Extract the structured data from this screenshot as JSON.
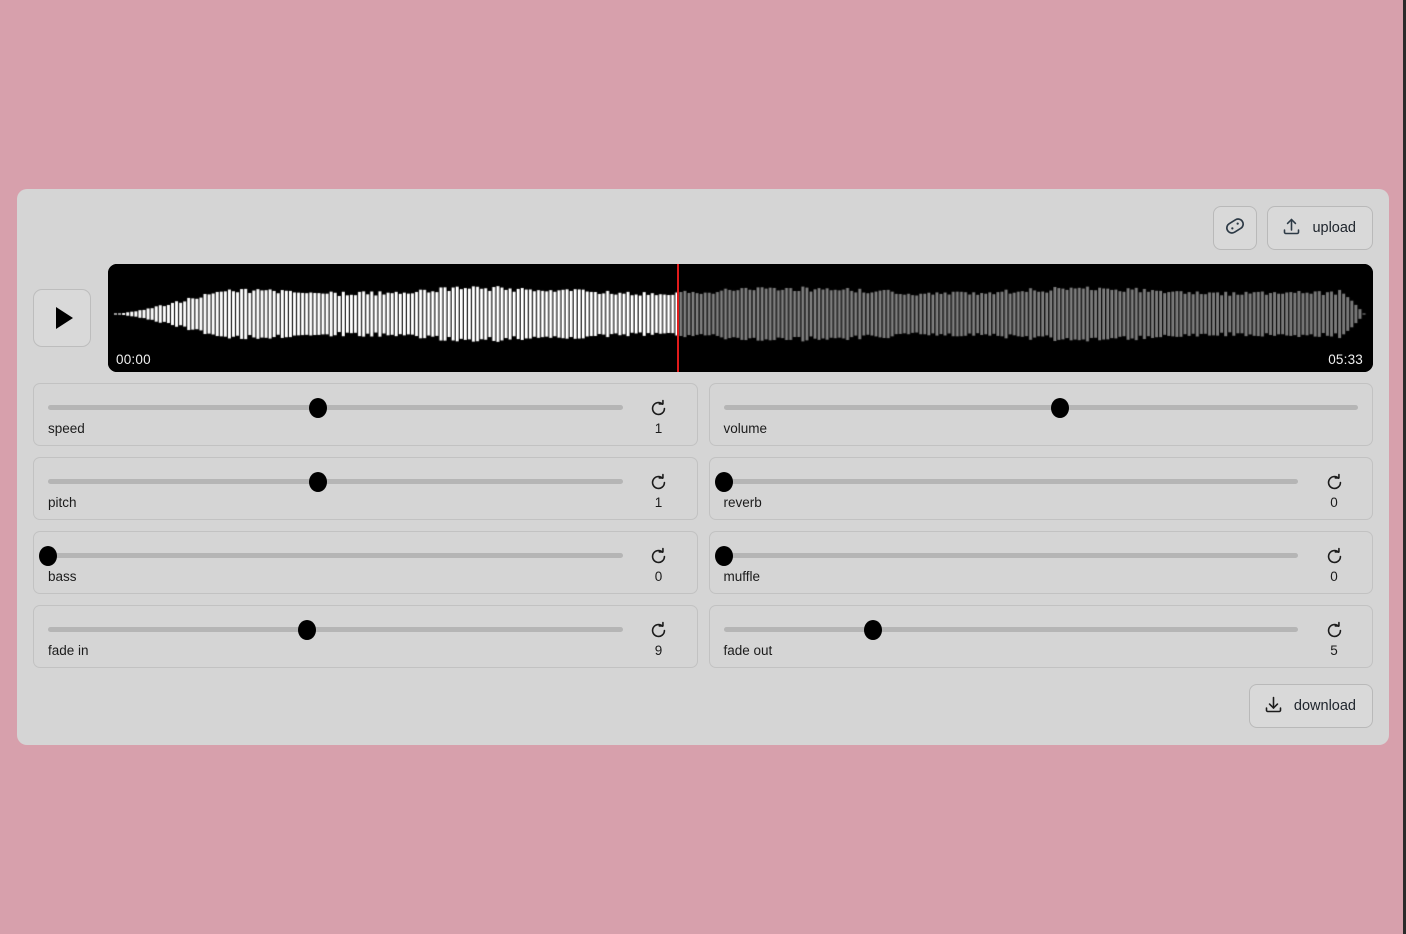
{
  "theme": {
    "page_background": "#d7a0ac",
    "panel_background": "#d5d5d5",
    "control_background": "#d5d5d5",
    "track_color": "#b5b5b5",
    "thumb_color": "#000000",
    "waveform_played_color": "#ffffff",
    "waveform_unplayed_color": "#7a7a7a",
    "waveform_background": "#000000",
    "playhead_color": "#e01b1b",
    "text_color": "#1b1b1b"
  },
  "toolbar": {
    "tag_button": {
      "icon": "tag-icon",
      "label": ""
    },
    "upload_button": {
      "icon": "upload-icon",
      "label": "upload"
    }
  },
  "player": {
    "play_button": {
      "icon": "play-icon",
      "label": ""
    },
    "current_time": "00:00",
    "total_time": "05:33",
    "playhead_percent": 45
  },
  "controls": [
    {
      "name": "speed",
      "label": "speed",
      "value": "1",
      "percent": 47,
      "reset_icon": "rotate-cw-icon",
      "has_reset": true,
      "column": "left"
    },
    {
      "name": "volume",
      "label": "volume",
      "value": "",
      "percent": 53,
      "reset_icon": "",
      "has_reset": false,
      "column": "right"
    },
    {
      "name": "pitch",
      "label": "pitch",
      "value": "1",
      "percent": 47,
      "reset_icon": "rotate-cw-icon",
      "has_reset": true,
      "column": "left"
    },
    {
      "name": "reverb",
      "label": "reverb",
      "value": "0",
      "percent": 0,
      "reset_icon": "rotate-cw-icon",
      "has_reset": true,
      "column": "right"
    },
    {
      "name": "bass",
      "label": "bass",
      "value": "0",
      "percent": 0,
      "reset_icon": "rotate-cw-icon",
      "has_reset": true,
      "column": "left"
    },
    {
      "name": "muffle",
      "label": "muffle",
      "value": "0",
      "percent": 0,
      "reset_icon": "rotate-cw-icon",
      "has_reset": true,
      "column": "right"
    },
    {
      "name": "fade-in",
      "label": "fade in",
      "value": "9",
      "percent": 45,
      "reset_icon": "rotate-cw-icon",
      "has_reset": true,
      "column": "left"
    },
    {
      "name": "fade-out",
      "label": "fade out",
      "value": "5",
      "percent": 26,
      "reset_icon": "rotate-cw-icon",
      "has_reset": true,
      "column": "right"
    }
  ],
  "footer": {
    "download_button": {
      "icon": "download-icon",
      "label": "download"
    }
  }
}
